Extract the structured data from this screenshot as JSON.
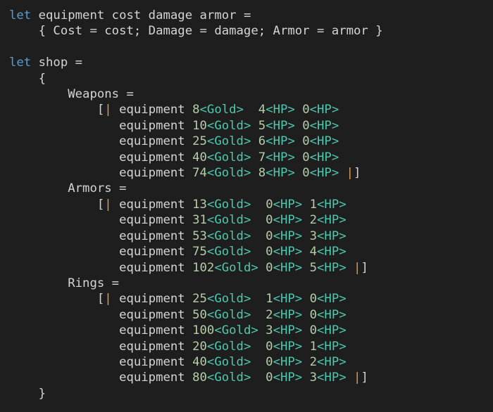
{
  "editor": {
    "language": "fsharp",
    "background_color": "#1e1e1e",
    "foreground_color": "#d4d4d4",
    "colors": {
      "keyword": "#569cd6",
      "number": "#b5cea8",
      "type_unit": "#4ec9b0",
      "bracket_pair": "#da9a55",
      "plain": "#d4d4d4"
    },
    "lines": [
      {
        "index": 0,
        "text": "let equipment cost damage armor =",
        "tokens": [
          {
            "t": "let",
            "c": "kw"
          },
          {
            "t": " equipment cost damage armor =",
            "c": "plain"
          }
        ]
      },
      {
        "index": 1,
        "text": "    { Cost = cost; Damage = damage; Armor = armor }",
        "tokens": [
          {
            "t": "    { Cost = cost; Damage = damage; Armor = armor }",
            "c": "plain"
          }
        ]
      },
      {
        "index": 2,
        "text": "",
        "tokens": []
      },
      {
        "index": 3,
        "text": "let shop =",
        "tokens": [
          {
            "t": "let",
            "c": "kw"
          },
          {
            "t": " shop =",
            "c": "plain"
          }
        ]
      },
      {
        "index": 4,
        "text": "    {",
        "tokens": [
          {
            "t": "    ",
            "c": "plain"
          },
          {
            "t": "{",
            "c": "brk0"
          }
        ]
      },
      {
        "index": 5,
        "text": "        Weapons =",
        "tokens": [
          {
            "t": "        Weapons =",
            "c": "plain"
          }
        ]
      },
      {
        "index": 6,
        "text": "            [| equipment 8<Gold>  4<HP> 0<HP>",
        "tokens": [
          {
            "t": "            ",
            "c": "plain"
          },
          {
            "t": "[",
            "c": "brk0"
          },
          {
            "t": "|",
            "c": "brk1"
          },
          {
            "t": " equipment ",
            "c": "plain"
          },
          {
            "t": "8",
            "c": "num"
          },
          {
            "t": "<Gold>",
            "c": "type"
          },
          {
            "t": "  ",
            "c": "plain"
          },
          {
            "t": "4",
            "c": "num"
          },
          {
            "t": "<HP>",
            "c": "type"
          },
          {
            "t": " ",
            "c": "plain"
          },
          {
            "t": "0",
            "c": "num"
          },
          {
            "t": "<HP>",
            "c": "type"
          }
        ]
      },
      {
        "index": 7,
        "text": "               equipment 10<Gold> 5<HP> 0<HP>",
        "tokens": [
          {
            "t": "               equipment ",
            "c": "plain"
          },
          {
            "t": "10",
            "c": "num"
          },
          {
            "t": "<Gold>",
            "c": "type"
          },
          {
            "t": " ",
            "c": "plain"
          },
          {
            "t": "5",
            "c": "num"
          },
          {
            "t": "<HP>",
            "c": "type"
          },
          {
            "t": " ",
            "c": "plain"
          },
          {
            "t": "0",
            "c": "num"
          },
          {
            "t": "<HP>",
            "c": "type"
          }
        ]
      },
      {
        "index": 8,
        "text": "               equipment 25<Gold> 6<HP> 0<HP>",
        "tokens": [
          {
            "t": "               equipment ",
            "c": "plain"
          },
          {
            "t": "25",
            "c": "num"
          },
          {
            "t": "<Gold>",
            "c": "type"
          },
          {
            "t": " ",
            "c": "plain"
          },
          {
            "t": "6",
            "c": "num"
          },
          {
            "t": "<HP>",
            "c": "type"
          },
          {
            "t": " ",
            "c": "plain"
          },
          {
            "t": "0",
            "c": "num"
          },
          {
            "t": "<HP>",
            "c": "type"
          }
        ]
      },
      {
        "index": 9,
        "text": "               equipment 40<Gold> 7<HP> 0<HP>",
        "tokens": [
          {
            "t": "               equipment ",
            "c": "plain"
          },
          {
            "t": "40",
            "c": "num"
          },
          {
            "t": "<Gold>",
            "c": "type"
          },
          {
            "t": " ",
            "c": "plain"
          },
          {
            "t": "7",
            "c": "num"
          },
          {
            "t": "<HP>",
            "c": "type"
          },
          {
            "t": " ",
            "c": "plain"
          },
          {
            "t": "0",
            "c": "num"
          },
          {
            "t": "<HP>",
            "c": "type"
          }
        ]
      },
      {
        "index": 10,
        "text": "               equipment 74<Gold> 8<HP> 0<HP> |]",
        "tokens": [
          {
            "t": "               equipment ",
            "c": "plain"
          },
          {
            "t": "74",
            "c": "num"
          },
          {
            "t": "<Gold>",
            "c": "type"
          },
          {
            "t": " ",
            "c": "plain"
          },
          {
            "t": "8",
            "c": "num"
          },
          {
            "t": "<HP>",
            "c": "type"
          },
          {
            "t": " ",
            "c": "plain"
          },
          {
            "t": "0",
            "c": "num"
          },
          {
            "t": "<HP>",
            "c": "type"
          },
          {
            "t": " ",
            "c": "plain"
          },
          {
            "t": "|",
            "c": "brk1"
          },
          {
            "t": "]",
            "c": "brk0"
          }
        ]
      },
      {
        "index": 11,
        "text": "        Armors =",
        "tokens": [
          {
            "t": "        Armors =",
            "c": "plain"
          }
        ]
      },
      {
        "index": 12,
        "text": "            [| equipment 13<Gold>  0<HP> 1<HP>",
        "tokens": [
          {
            "t": "            ",
            "c": "plain"
          },
          {
            "t": "[",
            "c": "brk0"
          },
          {
            "t": "|",
            "c": "brk1"
          },
          {
            "t": " equipment ",
            "c": "plain"
          },
          {
            "t": "13",
            "c": "num"
          },
          {
            "t": "<Gold>",
            "c": "type"
          },
          {
            "t": "  ",
            "c": "plain"
          },
          {
            "t": "0",
            "c": "num"
          },
          {
            "t": "<HP>",
            "c": "type"
          },
          {
            "t": " ",
            "c": "plain"
          },
          {
            "t": "1",
            "c": "num"
          },
          {
            "t": "<HP>",
            "c": "type"
          }
        ]
      },
      {
        "index": 13,
        "text": "               equipment 31<Gold>  0<HP> 2<HP>",
        "tokens": [
          {
            "t": "               equipment ",
            "c": "plain"
          },
          {
            "t": "31",
            "c": "num"
          },
          {
            "t": "<Gold>",
            "c": "type"
          },
          {
            "t": "  ",
            "c": "plain"
          },
          {
            "t": "0",
            "c": "num"
          },
          {
            "t": "<HP>",
            "c": "type"
          },
          {
            "t": " ",
            "c": "plain"
          },
          {
            "t": "2",
            "c": "num"
          },
          {
            "t": "<HP>",
            "c": "type"
          }
        ]
      },
      {
        "index": 14,
        "text": "               equipment 53<Gold>  0<HP> 3<HP>",
        "tokens": [
          {
            "t": "               equipment ",
            "c": "plain"
          },
          {
            "t": "53",
            "c": "num"
          },
          {
            "t": "<Gold>",
            "c": "type"
          },
          {
            "t": "  ",
            "c": "plain"
          },
          {
            "t": "0",
            "c": "num"
          },
          {
            "t": "<HP>",
            "c": "type"
          },
          {
            "t": " ",
            "c": "plain"
          },
          {
            "t": "3",
            "c": "num"
          },
          {
            "t": "<HP>",
            "c": "type"
          }
        ]
      },
      {
        "index": 15,
        "text": "               equipment 75<Gold>  0<HP> 4<HP>",
        "tokens": [
          {
            "t": "               equipment ",
            "c": "plain"
          },
          {
            "t": "75",
            "c": "num"
          },
          {
            "t": "<Gold>",
            "c": "type"
          },
          {
            "t": "  ",
            "c": "plain"
          },
          {
            "t": "0",
            "c": "num"
          },
          {
            "t": "<HP>",
            "c": "type"
          },
          {
            "t": " ",
            "c": "plain"
          },
          {
            "t": "4",
            "c": "num"
          },
          {
            "t": "<HP>",
            "c": "type"
          }
        ]
      },
      {
        "index": 16,
        "text": "               equipment 102<Gold> 0<HP> 5<HP> |]",
        "tokens": [
          {
            "t": "               equipment ",
            "c": "plain"
          },
          {
            "t": "102",
            "c": "num"
          },
          {
            "t": "<Gold>",
            "c": "type"
          },
          {
            "t": " ",
            "c": "plain"
          },
          {
            "t": "0",
            "c": "num"
          },
          {
            "t": "<HP>",
            "c": "type"
          },
          {
            "t": " ",
            "c": "plain"
          },
          {
            "t": "5",
            "c": "num"
          },
          {
            "t": "<HP>",
            "c": "type"
          },
          {
            "t": " ",
            "c": "plain"
          },
          {
            "t": "|",
            "c": "brk1"
          },
          {
            "t": "]",
            "c": "brk0"
          }
        ]
      },
      {
        "index": 17,
        "text": "        Rings =",
        "tokens": [
          {
            "t": "        Rings =",
            "c": "plain"
          }
        ]
      },
      {
        "index": 18,
        "text": "            [| equipment 25<Gold>  1<HP> 0<HP>",
        "tokens": [
          {
            "t": "            ",
            "c": "plain"
          },
          {
            "t": "[",
            "c": "brk0"
          },
          {
            "t": "|",
            "c": "brk1"
          },
          {
            "t": " equipment ",
            "c": "plain"
          },
          {
            "t": "25",
            "c": "num"
          },
          {
            "t": "<Gold>",
            "c": "type"
          },
          {
            "t": "  ",
            "c": "plain"
          },
          {
            "t": "1",
            "c": "num"
          },
          {
            "t": "<HP>",
            "c": "type"
          },
          {
            "t": " ",
            "c": "plain"
          },
          {
            "t": "0",
            "c": "num"
          },
          {
            "t": "<HP>",
            "c": "type"
          }
        ]
      },
      {
        "index": 19,
        "text": "               equipment 50<Gold>  2<HP> 0<HP>",
        "tokens": [
          {
            "t": "               equipment ",
            "c": "plain"
          },
          {
            "t": "50",
            "c": "num"
          },
          {
            "t": "<Gold>",
            "c": "type"
          },
          {
            "t": "  ",
            "c": "plain"
          },
          {
            "t": "2",
            "c": "num"
          },
          {
            "t": "<HP>",
            "c": "type"
          },
          {
            "t": " ",
            "c": "plain"
          },
          {
            "t": "0",
            "c": "num"
          },
          {
            "t": "<HP>",
            "c": "type"
          }
        ]
      },
      {
        "index": 20,
        "text": "               equipment 100<Gold> 3<HP> 0<HP>",
        "tokens": [
          {
            "t": "               equipment ",
            "c": "plain"
          },
          {
            "t": "100",
            "c": "num"
          },
          {
            "t": "<Gold>",
            "c": "type"
          },
          {
            "t": " ",
            "c": "plain"
          },
          {
            "t": "3",
            "c": "num"
          },
          {
            "t": "<HP>",
            "c": "type"
          },
          {
            "t": " ",
            "c": "plain"
          },
          {
            "t": "0",
            "c": "num"
          },
          {
            "t": "<HP>",
            "c": "type"
          }
        ]
      },
      {
        "index": 21,
        "text": "               equipment 20<Gold>  0<HP> 1<HP>",
        "tokens": [
          {
            "t": "               equipment ",
            "c": "plain"
          },
          {
            "t": "20",
            "c": "num"
          },
          {
            "t": "<Gold>",
            "c": "type"
          },
          {
            "t": "  ",
            "c": "plain"
          },
          {
            "t": "0",
            "c": "num"
          },
          {
            "t": "<HP>",
            "c": "type"
          },
          {
            "t": " ",
            "c": "plain"
          },
          {
            "t": "1",
            "c": "num"
          },
          {
            "t": "<HP>",
            "c": "type"
          }
        ]
      },
      {
        "index": 22,
        "text": "               equipment 40<Gold>  0<HP> 2<HP>",
        "tokens": [
          {
            "t": "               equipment ",
            "c": "plain"
          },
          {
            "t": "40",
            "c": "num"
          },
          {
            "t": "<Gold>",
            "c": "type"
          },
          {
            "t": "  ",
            "c": "plain"
          },
          {
            "t": "0",
            "c": "num"
          },
          {
            "t": "<HP>",
            "c": "type"
          },
          {
            "t": " ",
            "c": "plain"
          },
          {
            "t": "2",
            "c": "num"
          },
          {
            "t": "<HP>",
            "c": "type"
          }
        ]
      },
      {
        "index": 23,
        "text": "               equipment 80<Gold>  0<HP> 3<HP> |]",
        "tokens": [
          {
            "t": "               equipment ",
            "c": "plain"
          },
          {
            "t": "80",
            "c": "num"
          },
          {
            "t": "<Gold>",
            "c": "type"
          },
          {
            "t": "  ",
            "c": "plain"
          },
          {
            "t": "0",
            "c": "num"
          },
          {
            "t": "<HP>",
            "c": "type"
          },
          {
            "t": " ",
            "c": "plain"
          },
          {
            "t": "3",
            "c": "num"
          },
          {
            "t": "<HP>",
            "c": "type"
          },
          {
            "t": " ",
            "c": "plain"
          },
          {
            "t": "|",
            "c": "brk1"
          },
          {
            "t": "]",
            "c": "brk0"
          }
        ]
      },
      {
        "index": 24,
        "text": "    }",
        "tokens": [
          {
            "t": "    ",
            "c": "plain"
          },
          {
            "t": "}",
            "c": "brk0"
          }
        ]
      }
    ]
  },
  "shop_data": {
    "record_fields": [
      "Cost",
      "Damage",
      "Armor"
    ],
    "categories": [
      {
        "name": "Weapons",
        "items": [
          {
            "cost": 8,
            "cost_unit": "Gold",
            "damage": 4,
            "damage_unit": "HP",
            "armor": 0,
            "armor_unit": "HP"
          },
          {
            "cost": 10,
            "cost_unit": "Gold",
            "damage": 5,
            "damage_unit": "HP",
            "armor": 0,
            "armor_unit": "HP"
          },
          {
            "cost": 25,
            "cost_unit": "Gold",
            "damage": 6,
            "damage_unit": "HP",
            "armor": 0,
            "armor_unit": "HP"
          },
          {
            "cost": 40,
            "cost_unit": "Gold",
            "damage": 7,
            "damage_unit": "HP",
            "armor": 0,
            "armor_unit": "HP"
          },
          {
            "cost": 74,
            "cost_unit": "Gold",
            "damage": 8,
            "damage_unit": "HP",
            "armor": 0,
            "armor_unit": "HP"
          }
        ]
      },
      {
        "name": "Armors",
        "items": [
          {
            "cost": 13,
            "cost_unit": "Gold",
            "damage": 0,
            "damage_unit": "HP",
            "armor": 1,
            "armor_unit": "HP"
          },
          {
            "cost": 31,
            "cost_unit": "Gold",
            "damage": 0,
            "damage_unit": "HP",
            "armor": 2,
            "armor_unit": "HP"
          },
          {
            "cost": 53,
            "cost_unit": "Gold",
            "damage": 0,
            "damage_unit": "HP",
            "armor": 3,
            "armor_unit": "HP"
          },
          {
            "cost": 75,
            "cost_unit": "Gold",
            "damage": 0,
            "damage_unit": "HP",
            "armor": 4,
            "armor_unit": "HP"
          },
          {
            "cost": 102,
            "cost_unit": "Gold",
            "damage": 0,
            "damage_unit": "HP",
            "armor": 5,
            "armor_unit": "HP"
          }
        ]
      },
      {
        "name": "Rings",
        "items": [
          {
            "cost": 25,
            "cost_unit": "Gold",
            "damage": 1,
            "damage_unit": "HP",
            "armor": 0,
            "armor_unit": "HP"
          },
          {
            "cost": 50,
            "cost_unit": "Gold",
            "damage": 2,
            "damage_unit": "HP",
            "armor": 0,
            "armor_unit": "HP"
          },
          {
            "cost": 100,
            "cost_unit": "Gold",
            "damage": 3,
            "damage_unit": "HP",
            "armor": 0,
            "armor_unit": "HP"
          },
          {
            "cost": 20,
            "cost_unit": "Gold",
            "damage": 0,
            "damage_unit": "HP",
            "armor": 1,
            "armor_unit": "HP"
          },
          {
            "cost": 40,
            "cost_unit": "Gold",
            "damage": 0,
            "damage_unit": "HP",
            "armor": 2,
            "armor_unit": "HP"
          },
          {
            "cost": 80,
            "cost_unit": "Gold",
            "damage": 0,
            "damage_unit": "HP",
            "armor": 3,
            "armor_unit": "HP"
          }
        ]
      }
    ]
  }
}
